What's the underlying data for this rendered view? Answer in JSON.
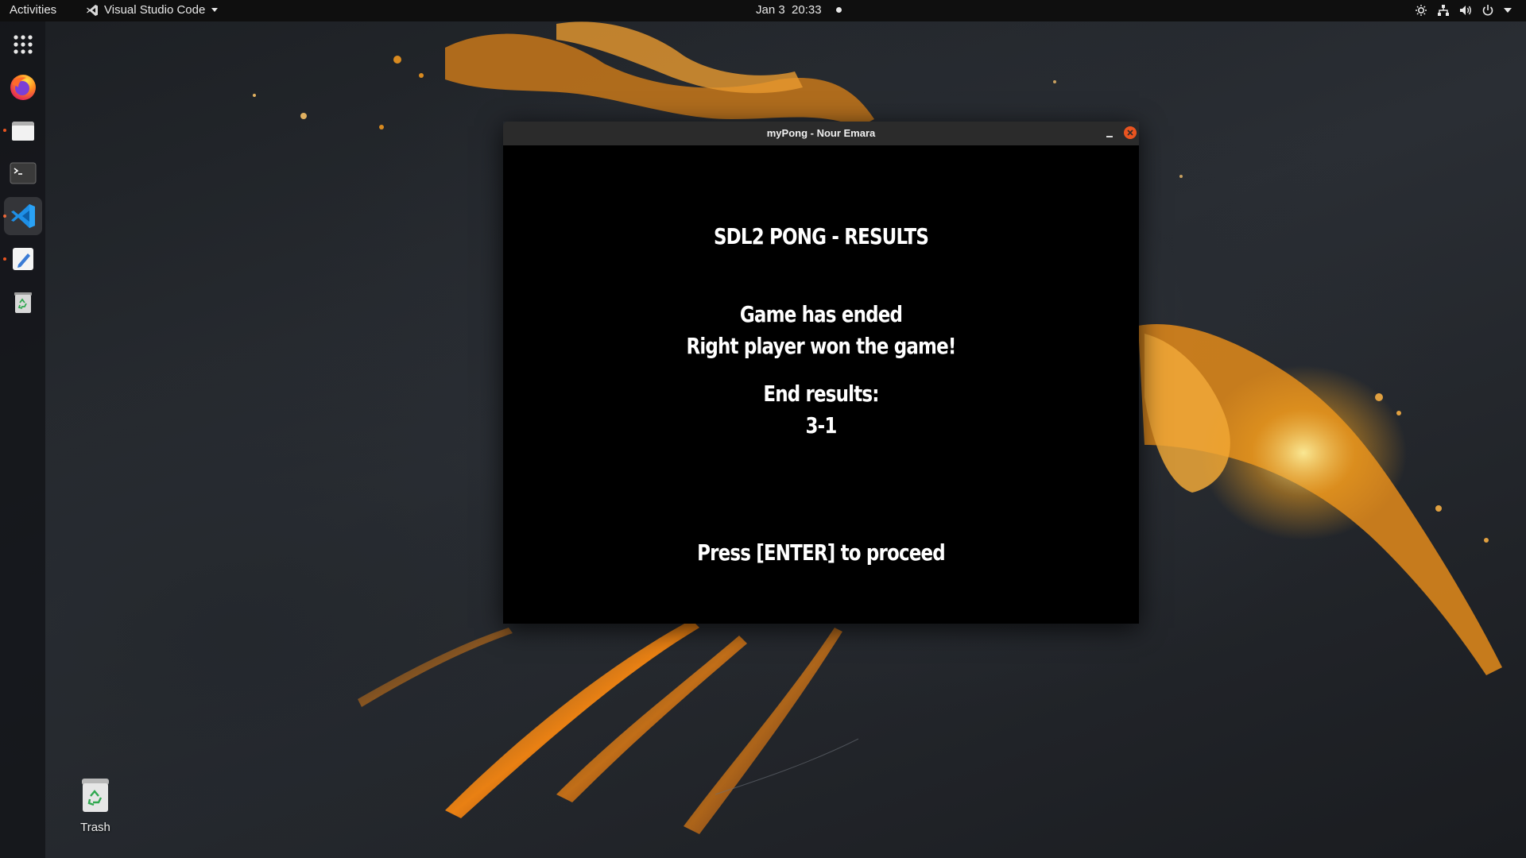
{
  "top_bar": {
    "activities_label": "Activities",
    "app_name": "Visual Studio Code",
    "date": "Jan 3",
    "time": "20:33",
    "tray_icons": [
      "weather-icon",
      "network-icon",
      "volume-icon",
      "power-icon",
      "chevron-down-icon"
    ]
  },
  "dock": {
    "items": [
      {
        "name": "Show Applications",
        "icon": "app-grid-icon",
        "running": false,
        "active": false
      },
      {
        "name": "Firefox",
        "icon": "firefox-icon",
        "running": false,
        "active": false
      },
      {
        "name": "Files",
        "icon": "files-icon",
        "running": true,
        "active": false
      },
      {
        "name": "Terminal",
        "icon": "terminal-icon",
        "running": false,
        "active": false
      },
      {
        "name": "Visual Studio Code",
        "icon": "vscode-icon",
        "running": true,
        "active": true
      },
      {
        "name": "Text Editor",
        "icon": "text-editor-icon",
        "running": true,
        "active": false
      },
      {
        "name": "Trash",
        "icon": "trash-icon",
        "running": false,
        "active": false
      }
    ]
  },
  "desktop": {
    "trash_label": "Trash"
  },
  "window": {
    "title": "myPong - Nour Emara",
    "game": {
      "heading": "SDL2 PONG - RESULTS",
      "status_line_1": "Game has ended",
      "status_line_2": "Right player won the game!",
      "results_label": "End results:",
      "score": "3-1",
      "prompt": "Press [ENTER] to proceed"
    }
  },
  "colors": {
    "accent": "#e95420",
    "top_bar": "#0f0f0f",
    "window_title_bar": "#2b2b2b",
    "game_background": "#000000",
    "game_text": "#ffffff"
  }
}
